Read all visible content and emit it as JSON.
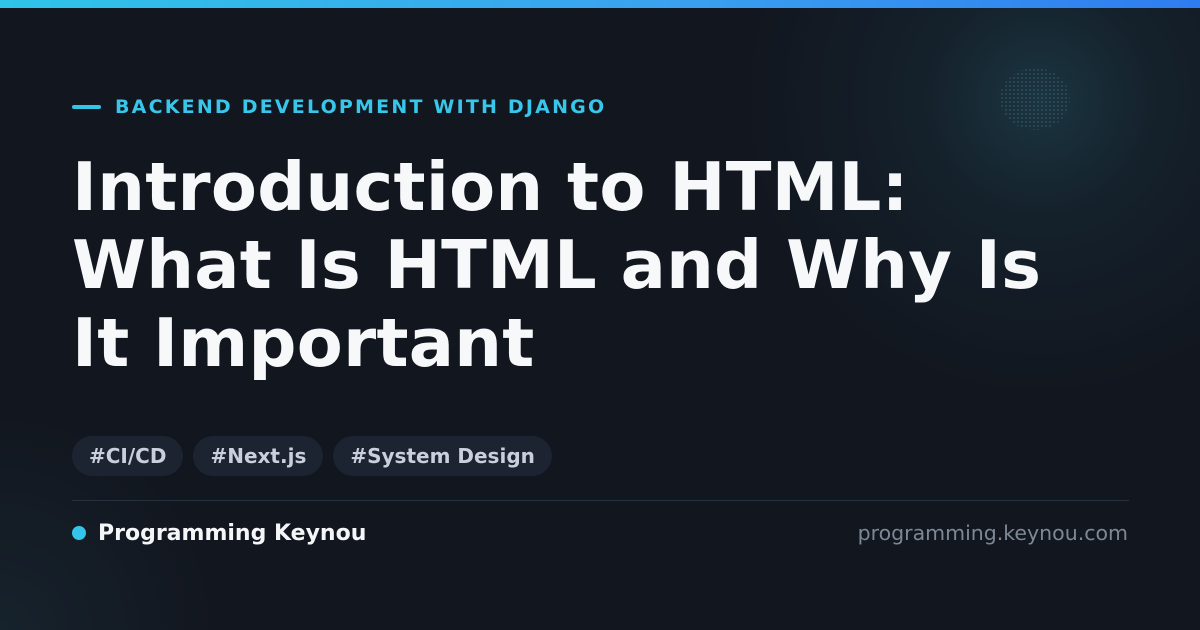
{
  "header": {
    "category": "BACKEND DEVELOPMENT WITH DJANGO"
  },
  "article": {
    "title_lines": [
      "Introduction to HTML:",
      "What Is HTML and Why Is",
      "It Important"
    ]
  },
  "tags": [
    "#CI/CD",
    "#Next.js",
    "#System Design"
  ],
  "footer": {
    "brand_name": "Programming Keynou",
    "site_url": "programming.keynou.com"
  },
  "colors": {
    "accent": "#33c4e6",
    "top_bar_start": "#2fc4e8",
    "top_bar_end": "#2f7cf0",
    "background": "#12161f",
    "tag_background": "#1c2431"
  }
}
